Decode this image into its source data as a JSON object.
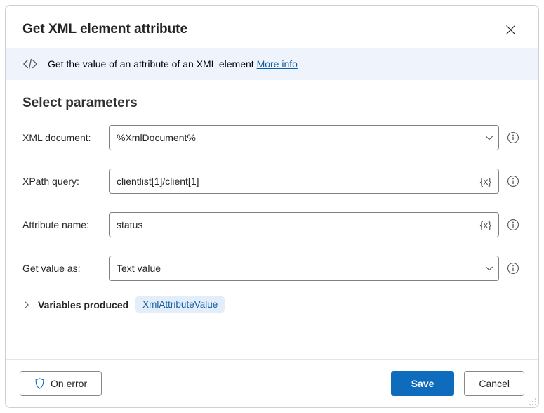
{
  "dialog": {
    "title": "Get XML element attribute"
  },
  "info": {
    "text": "Get the value of an attribute of an XML element",
    "link": "More info"
  },
  "section": {
    "title": "Select parameters"
  },
  "fields": {
    "xml_document": {
      "label": "XML document:",
      "value": "%XmlDocument%"
    },
    "xpath_query": {
      "label": "XPath query:",
      "value": "clientlist[1]/client[1]"
    },
    "attr_name": {
      "label": "Attribute name:",
      "value": "status"
    },
    "get_value_as": {
      "label": "Get value as:",
      "value": "Text value"
    }
  },
  "variables": {
    "label": "Variables produced",
    "pill": "XmlAttributeValue"
  },
  "footer": {
    "on_error": "On error",
    "save": "Save",
    "cancel": "Cancel"
  }
}
